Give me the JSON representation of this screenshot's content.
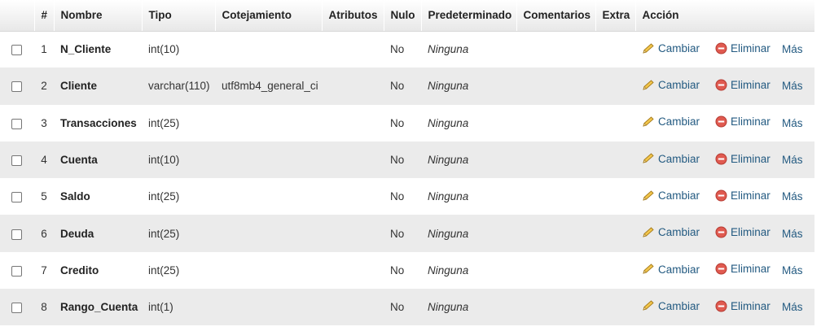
{
  "headers": {
    "num": "#",
    "name": "Nombre",
    "type": "Tipo",
    "collation": "Cotejamiento",
    "attributes": "Atributos",
    "null": "Nulo",
    "default": "Predeterminado",
    "comments": "Comentarios",
    "extra": "Extra",
    "action": "Acción"
  },
  "actions": {
    "change": "Cambiar",
    "drop": "Eliminar",
    "more": "Más"
  },
  "rows": [
    {
      "num": "1",
      "name": "N_Cliente",
      "type": "int(10)",
      "collation": "",
      "attributes": "",
      "null": "No",
      "default": "Ninguna",
      "comments": "",
      "extra": ""
    },
    {
      "num": "2",
      "name": "Cliente",
      "type": "varchar(110)",
      "collation": "utf8mb4_general_ci",
      "attributes": "",
      "null": "No",
      "default": "Ninguna",
      "comments": "",
      "extra": ""
    },
    {
      "num": "3",
      "name": "Transacciones",
      "type": "int(25)",
      "collation": "",
      "attributes": "",
      "null": "No",
      "default": "Ninguna",
      "comments": "",
      "extra": ""
    },
    {
      "num": "4",
      "name": "Cuenta",
      "type": "int(10)",
      "collation": "",
      "attributes": "",
      "null": "No",
      "default": "Ninguna",
      "comments": "",
      "extra": ""
    },
    {
      "num": "5",
      "name": "Saldo",
      "type": "int(25)",
      "collation": "",
      "attributes": "",
      "null": "No",
      "default": "Ninguna",
      "comments": "",
      "extra": ""
    },
    {
      "num": "6",
      "name": "Deuda",
      "type": "int(25)",
      "collation": "",
      "attributes": "",
      "null": "No",
      "default": "Ninguna",
      "comments": "",
      "extra": ""
    },
    {
      "num": "7",
      "name": "Credito",
      "type": "int(25)",
      "collation": "",
      "attributes": "",
      "null": "No",
      "default": "Ninguna",
      "comments": "",
      "extra": ""
    },
    {
      "num": "8",
      "name": "Rango_Cuenta",
      "type": "int(1)",
      "collation": "",
      "attributes": "",
      "null": "No",
      "default": "Ninguna",
      "comments": "",
      "extra": ""
    }
  ],
  "colors": {
    "link": "#235a81",
    "row_alt": "#ebebeb",
    "pencil": "#e8b33a",
    "drop": "#d9534f"
  },
  "icons": {
    "change": "pencil-icon",
    "drop": "minus-circle-icon"
  }
}
